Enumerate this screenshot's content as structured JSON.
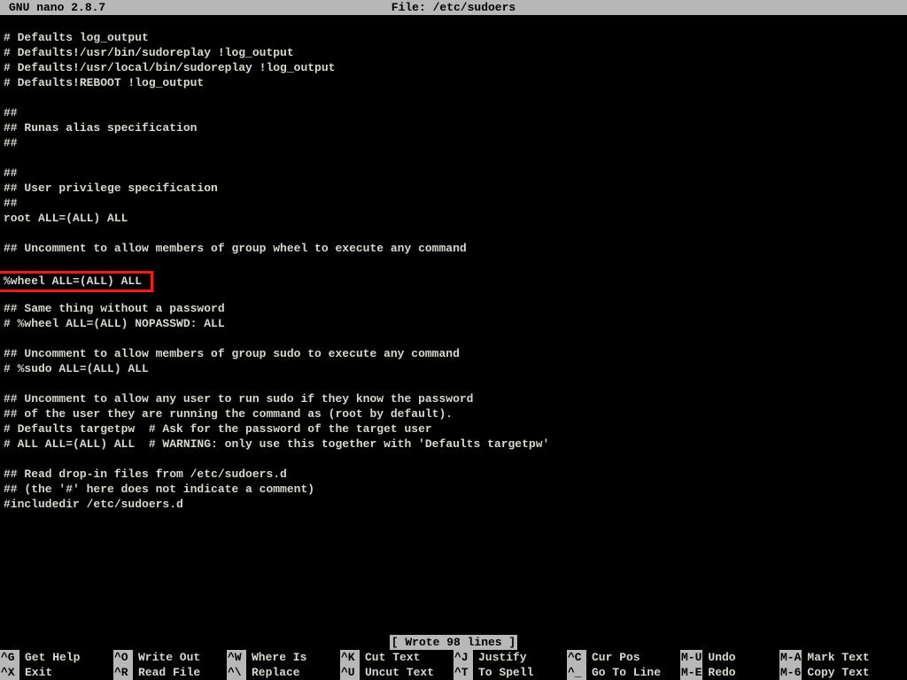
{
  "titlebar": {
    "app": "GNU nano 2.8.7",
    "file": "File: /etc/sudoers"
  },
  "lines": [
    "# Defaults log_output",
    "# Defaults!/usr/bin/sudoreplay !log_output",
    "# Defaults!/usr/local/bin/sudoreplay !log_output",
    "# Defaults!REBOOT !log_output",
    "",
    "##",
    "## Runas alias specification",
    "##",
    "",
    "##",
    "## User privilege specification",
    "##",
    "root ALL=(ALL) ALL",
    "",
    "## Uncomment to allow members of group wheel to execute any command",
    "",
    "%wheel ALL=(ALL) ALL",
    "",
    "## Same thing without a password",
    "# %wheel ALL=(ALL) NOPASSWD: ALL",
    "",
    "## Uncomment to allow members of group sudo to execute any command",
    "# %sudo ALL=(ALL) ALL",
    "",
    "## Uncomment to allow any user to run sudo if they know the password",
    "## of the user they are running the command as (root by default).",
    "# Defaults targetpw  # Ask for the password of the target user",
    "# ALL ALL=(ALL) ALL  # WARNING: only use this together with 'Defaults targetpw'",
    "",
    "## Read drop-in files from /etc/sudoers.d",
    "## (the '#' here does not indicate a comment)",
    "#includedir /etc/sudoers.d"
  ],
  "highlight_index": 16,
  "status": "[ Wrote 98 lines ]",
  "shortcuts": [
    [
      {
        "key": "^G",
        "label": "Get Help"
      },
      {
        "key": "^X",
        "label": "Exit"
      }
    ],
    [
      {
        "key": "^O",
        "label": "Write Out"
      },
      {
        "key": "^R",
        "label": "Read File"
      }
    ],
    [
      {
        "key": "^W",
        "label": "Where Is"
      },
      {
        "key": "^\\",
        "label": "Replace"
      }
    ],
    [
      {
        "key": "^K",
        "label": "Cut Text"
      },
      {
        "key": "^U",
        "label": "Uncut Text"
      }
    ],
    [
      {
        "key": "^J",
        "label": "Justify"
      },
      {
        "key": "^T",
        "label": "To Spell"
      }
    ],
    [
      {
        "key": "^C",
        "label": "Cur Pos"
      },
      {
        "key": "^_",
        "label": "Go To Line"
      }
    ],
    [
      {
        "key": "M-U",
        "label": "Undo"
      },
      {
        "key": "M-E",
        "label": "Redo"
      }
    ],
    [
      {
        "key": "M-A",
        "label": "Mark Text"
      },
      {
        "key": "M-6",
        "label": "Copy Text"
      }
    ]
  ]
}
